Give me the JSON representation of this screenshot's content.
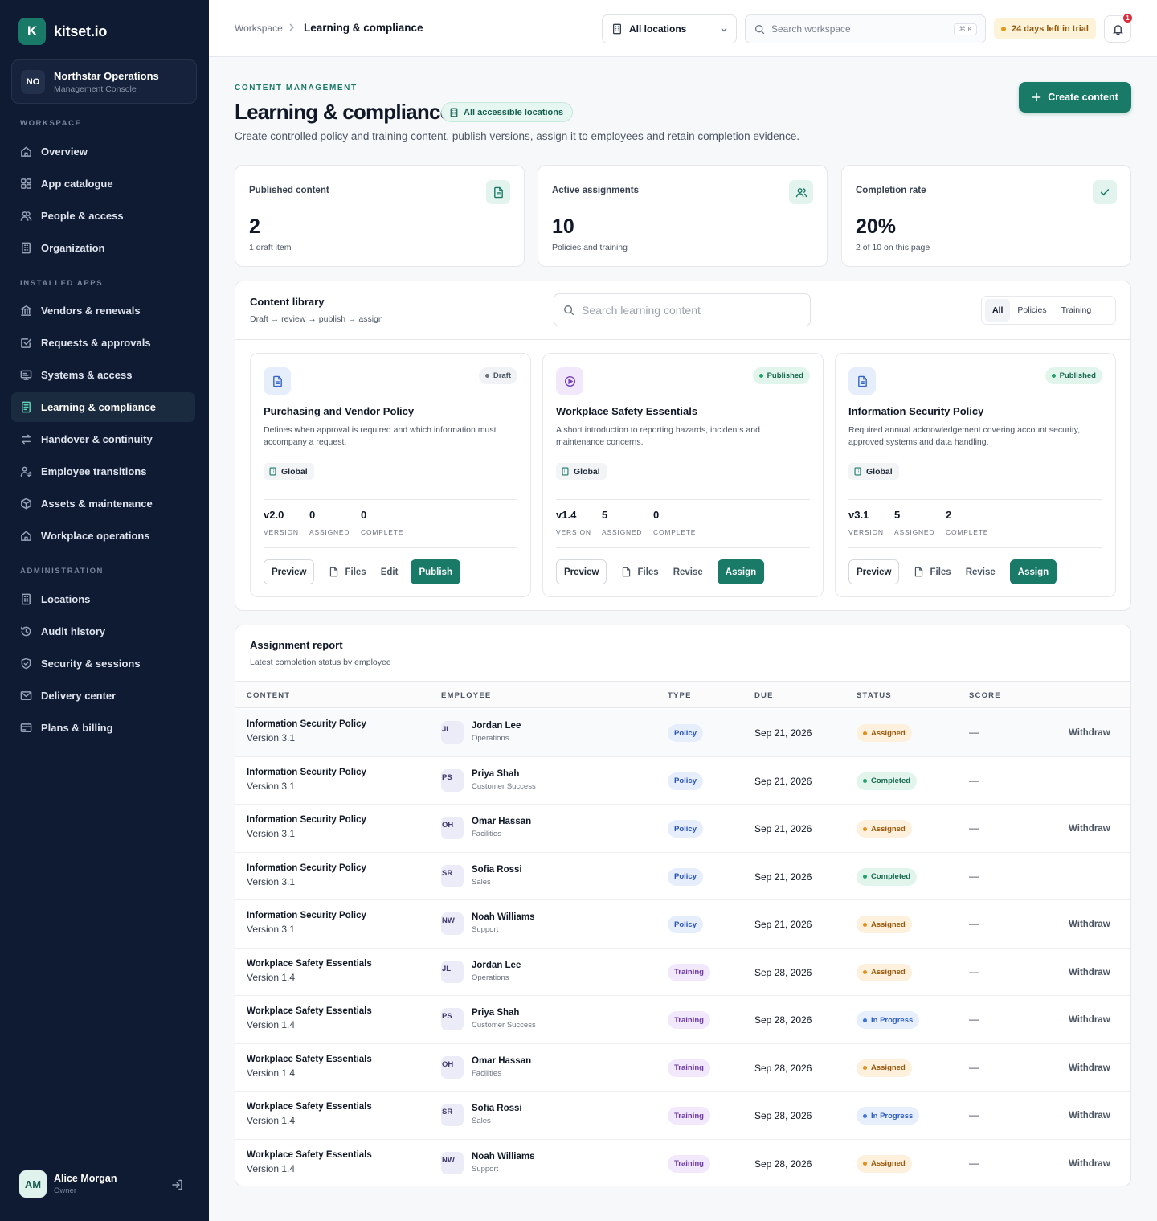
{
  "sidebar": {
    "brand_initial": "K",
    "brand_name": "kitset.io",
    "org": {
      "initials": "NO",
      "name": "Northstar Operations",
      "subtitle": "Management Console"
    },
    "sections": {
      "workspace": "WORKSPACE",
      "installed": "INSTALLED APPS",
      "admin": "ADMINISTRATION"
    },
    "workspace_items": [
      {
        "label": "Overview",
        "icon": "home-icon"
      },
      {
        "label": "App catalogue",
        "icon": "grid-icon"
      },
      {
        "label": "People & access",
        "icon": "users-icon"
      },
      {
        "label": "Organization",
        "icon": "building-icon"
      }
    ],
    "app_items": [
      {
        "label": "Vendors & renewals",
        "icon": "bank-icon"
      },
      {
        "label": "Requests & approvals",
        "icon": "check-square-icon"
      },
      {
        "label": "Systems & access",
        "icon": "monitor-icon"
      },
      {
        "label": "Learning & compliance",
        "icon": "document-icon",
        "active": true
      },
      {
        "label": "Handover & continuity",
        "icon": "swap-icon"
      },
      {
        "label": "Employee transitions",
        "icon": "user-transfer-icon"
      },
      {
        "label": "Assets & maintenance",
        "icon": "box-icon"
      },
      {
        "label": "Workplace operations",
        "icon": "home-icon"
      }
    ],
    "admin_items": [
      {
        "label": "Locations",
        "icon": "building-icon"
      },
      {
        "label": "Audit history",
        "icon": "history-icon"
      },
      {
        "label": "Security & sessions",
        "icon": "shield-icon"
      },
      {
        "label": "Delivery center",
        "icon": "mail-icon"
      },
      {
        "label": "Plans & billing",
        "icon": "credit-card-icon"
      }
    ],
    "user": {
      "initials": "AM",
      "name": "Alice Morgan",
      "role": "Owner"
    }
  },
  "topbar": {
    "breadcrumb_root": "Workspace",
    "breadcrumb_current": "Learning & compliance",
    "location_select": "All locations",
    "search_placeholder": "Search workspace",
    "search_shortcut": "⌘ K",
    "trial": "24 days left in trial",
    "notifications": "1"
  },
  "header": {
    "eyebrow": "CONTENT MANAGEMENT",
    "title": "Learning & compliance",
    "location_chip": "All accessible locations",
    "description": "Create controlled policy and training content, publish versions, assign it to employees and retain completion evidence.",
    "create_button": "Create content"
  },
  "stats": [
    {
      "label": "Published content",
      "value": "2",
      "sub": "1 draft item",
      "icon": "document-icon"
    },
    {
      "label": "Active assignments",
      "value": "10",
      "sub": "Policies and training",
      "icon": "users-icon"
    },
    {
      "label": "Completion rate",
      "value": "20%",
      "sub": "2 of 10 on this page",
      "icon": "check-icon"
    }
  ],
  "library": {
    "title": "Content library",
    "subtitle": "Draft → review → publish → assign",
    "search_placeholder": "Search learning content",
    "filters": [
      "All",
      "Policies",
      "Training"
    ],
    "metric_labels": {
      "version": "VERSION",
      "assigned": "ASSIGNED",
      "complete": "COMPLETE"
    },
    "buttons": {
      "preview": "Preview",
      "files": "Files"
    },
    "cards": [
      {
        "title": "Purchasing and Vendor Policy",
        "status": "Draft",
        "description": "Defines when approval is required and which information must accompany a request.",
        "scope": "Global",
        "version": "v2.0",
        "assigned": "0",
        "complete": "0",
        "secondary": "Edit",
        "primary": "Publish",
        "icon": "document-icon"
      },
      {
        "title": "Workplace Safety Essentials",
        "status": "Published",
        "description": "A short introduction to reporting hazards, incidents and maintenance concerns.",
        "scope": "Global",
        "version": "v1.4",
        "assigned": "5",
        "complete": "0",
        "secondary": "Revise",
        "primary": "Assign",
        "icon": "play-icon"
      },
      {
        "title": "Information Security Policy",
        "status": "Published",
        "description": "Required annual acknowledgement covering account security, approved systems and data handling.",
        "scope": "Global",
        "version": "v3.1",
        "assigned": "5",
        "complete": "2",
        "secondary": "Revise",
        "primary": "Assign",
        "icon": "document-icon"
      }
    ]
  },
  "report": {
    "title": "Assignment report",
    "subtitle": "Latest completion status by employee",
    "columns": [
      "CONTENT",
      "EMPLOYEE",
      "TYPE",
      "DUE",
      "STATUS",
      "SCORE"
    ],
    "rows": [
      {
        "content": "Information Security Policy",
        "version": "Version 3.1",
        "initials": "JL",
        "employee": "Jordan Lee",
        "dept": "Operations",
        "type": "Policy",
        "due": "Sep 21, 2026",
        "status": "Assigned",
        "score": "—",
        "action": "Withdraw"
      },
      {
        "content": "Information Security Policy",
        "version": "Version 3.1",
        "initials": "PS",
        "employee": "Priya Shah",
        "dept": "Customer Success",
        "type": "Policy",
        "due": "Sep 21, 2026",
        "status": "Completed",
        "score": "—",
        "action": ""
      },
      {
        "content": "Information Security Policy",
        "version": "Version 3.1",
        "initials": "OH",
        "employee": "Omar Hassan",
        "dept": "Facilities",
        "type": "Policy",
        "due": "Sep 21, 2026",
        "status": "Assigned",
        "score": "—",
        "action": "Withdraw"
      },
      {
        "content": "Information Security Policy",
        "version": "Version 3.1",
        "initials": "SR",
        "employee": "Sofia Rossi",
        "dept": "Sales",
        "type": "Policy",
        "due": "Sep 21, 2026",
        "status": "Completed",
        "score": "—",
        "action": ""
      },
      {
        "content": "Information Security Policy",
        "version": "Version 3.1",
        "initials": "NW",
        "employee": "Noah Williams",
        "dept": "Support",
        "type": "Policy",
        "due": "Sep 21, 2026",
        "status": "Assigned",
        "score": "—",
        "action": "Withdraw"
      },
      {
        "content": "Workplace Safety Essentials",
        "version": "Version 1.4",
        "initials": "JL",
        "employee": "Jordan Lee",
        "dept": "Operations",
        "type": "Training",
        "due": "Sep 28, 2026",
        "status": "Assigned",
        "score": "—",
        "action": "Withdraw"
      },
      {
        "content": "Workplace Safety Essentials",
        "version": "Version 1.4",
        "initials": "PS",
        "employee": "Priya Shah",
        "dept": "Customer Success",
        "type": "Training",
        "due": "Sep 28, 2026",
        "status": "In Progress",
        "score": "—",
        "action": "Withdraw"
      },
      {
        "content": "Workplace Safety Essentials",
        "version": "Version 1.4",
        "initials": "OH",
        "employee": "Omar Hassan",
        "dept": "Facilities",
        "type": "Training",
        "due": "Sep 28, 2026",
        "status": "Assigned",
        "score": "—",
        "action": "Withdraw"
      },
      {
        "content": "Workplace Safety Essentials",
        "version": "Version 1.4",
        "initials": "SR",
        "employee": "Sofia Rossi",
        "dept": "Sales",
        "type": "Training",
        "due": "Sep 28, 2026",
        "status": "In Progress",
        "score": "—",
        "action": "Withdraw"
      },
      {
        "content": "Workplace Safety Essentials",
        "version": "Version 1.4",
        "initials": "NW",
        "employee": "Noah Williams",
        "dept": "Support",
        "type": "Training",
        "due": "Sep 28, 2026",
        "status": "Assigned",
        "score": "—",
        "action": "Withdraw"
      }
    ]
  },
  "colors": {
    "accent": "#1a7a68",
    "sidebar": "#0f1b33",
    "draft": "#6b7280",
    "published": "#22a06b"
  }
}
